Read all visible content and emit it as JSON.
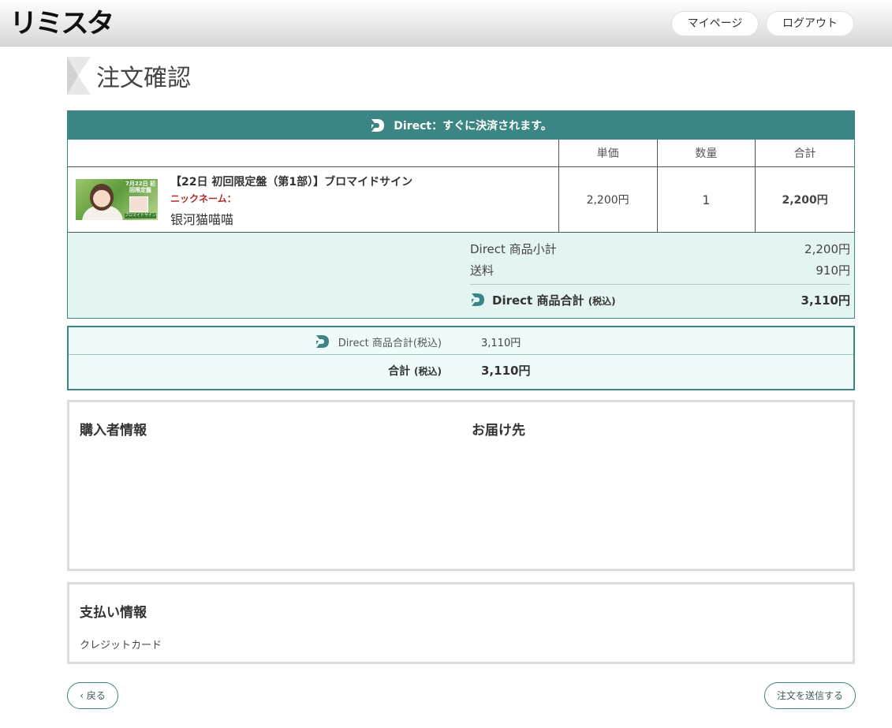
{
  "header": {
    "logo_text": "リミスタ",
    "mypage_label": "マイページ",
    "logout_label": "ログアウト"
  },
  "page_title": "注文確認",
  "order": {
    "banner": "Direct：すぐに決済されます。",
    "columns": {
      "unit_price": "単価",
      "quantity": "数量",
      "total": "合計"
    },
    "item": {
      "thumbnail_title": "7月22日 初回限定盤",
      "thumbnail_band": "ブロマイドサイン",
      "name": "【22日 初回限定盤（第1部）】ブロマイドサイン",
      "nickname_label": "ニックネーム：",
      "nickname_value": "银河猫喵喵",
      "unit_price": "2,200円",
      "quantity": "1",
      "total": "2,200円"
    },
    "summary": {
      "subtotal_label": "Direct 商品小計",
      "subtotal_value": "2,200円",
      "shipping_label": "送料",
      "shipping_value": "910円",
      "total_label": "Direct 商品合計",
      "total_tax": "(税込)",
      "total_value": "3,110円"
    }
  },
  "grand": {
    "direct_label": "Direct 商品合計(税込)",
    "direct_value": "3,110円",
    "total_label": "合計",
    "total_tax": "(税込)",
    "total_value": "3,110円"
  },
  "buyer_info": {
    "title": "購入者情報",
    "destination_title": "お届け先"
  },
  "payment_info": {
    "title": "支払い情報",
    "method": "クレジットカード"
  },
  "buttons": {
    "back": "‹ 戻る",
    "submit": "注文を送信する"
  },
  "colors": {
    "accent": "#3b8684",
    "summary_bg": "#e3f4f2",
    "nickname": "#b12a2a"
  }
}
